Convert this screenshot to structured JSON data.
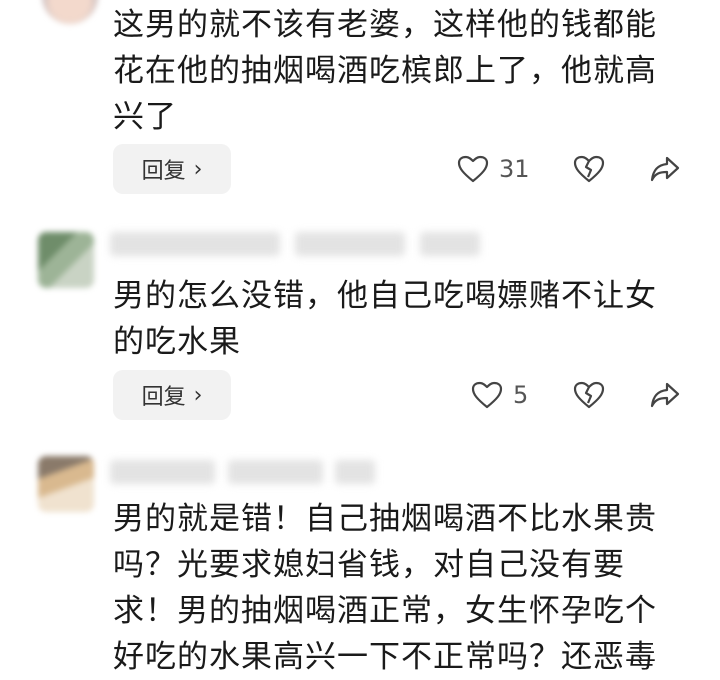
{
  "comments": [
    {
      "text_lines": [
        "这男的就不该有老婆，这样他的钱都能",
        "花在他的抽烟喝酒吃槟郎上了，他就高",
        "兴了"
      ],
      "reply_label": "回复",
      "likes": "31"
    },
    {
      "text_lines": [
        "男的怎么没错，他自己吃喝嫖赌不让女",
        "的吃水果"
      ],
      "reply_label": "回复",
      "likes": "5"
    },
    {
      "text_lines": [
        "男的就是错！自己抽烟喝酒不比水果贵",
        "吗？光要求媳妇省钱，对自己没有要",
        "求！男的抽烟喝酒正常，女生怀孕吃个",
        "好吃的水果高兴一下不正常吗？还恶毒"
      ]
    }
  ],
  "icons": {
    "reply_chevron": "chevron-right-icon",
    "like": "heart-outline-icon",
    "dislike": "broken-heart-icon",
    "share": "share-arrow-icon"
  }
}
